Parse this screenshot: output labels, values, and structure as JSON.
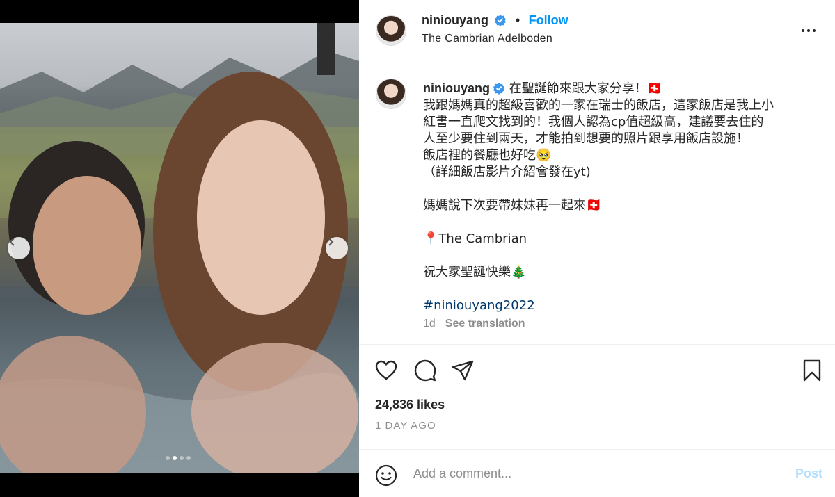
{
  "post": {
    "username": "niniouyang",
    "separator": "•",
    "follow_label": "Follow",
    "location": "The Cambrian Adelboden",
    "caption_first": "在聖誕節來跟大家分享！🇨🇭",
    "caption_lines": [
      "我跟媽媽真的超級喜歡的一家在瑞士的飯店，這家飯店是我上小",
      "紅書一直爬文找到的！我個人認為cp值超級高，建議要去住的",
      "人至少要住到兩天，才能拍到想要的照片跟享用飯店設施！",
      "飯店裡的餐廳也好吃🥹",
      "（詳細飯店影片介紹會發在yt)",
      "",
      "媽媽說下次要帶妹妹再一起來🇨🇭",
      "",
      "📍The Cambrian",
      "",
      "祝大家聖誕快樂🎄",
      ""
    ],
    "hashtag": "#niniouyang2022",
    "age": "1d",
    "see_translation": "See translation",
    "likes": "24,836 likes",
    "time_ago": "1 DAY AGO",
    "comment_placeholder": "Add a comment...",
    "post_label": "Post"
  },
  "carousel": {
    "count": 4,
    "active_index": 1
  },
  "icons": {
    "verified": "verified-badge-icon",
    "more": "more-options-icon",
    "like": "heart-icon",
    "comment": "comment-bubble-icon",
    "share": "paper-plane-icon",
    "save": "bookmark-icon",
    "emoji": "emoji-smiley-icon",
    "prev": "chevron-left-icon",
    "next": "chevron-right-icon"
  },
  "colors": {
    "link": "#0095f6",
    "hashtag": "#00376b",
    "muted": "#8e8e8e",
    "post_disabled": "#b2dffc"
  }
}
